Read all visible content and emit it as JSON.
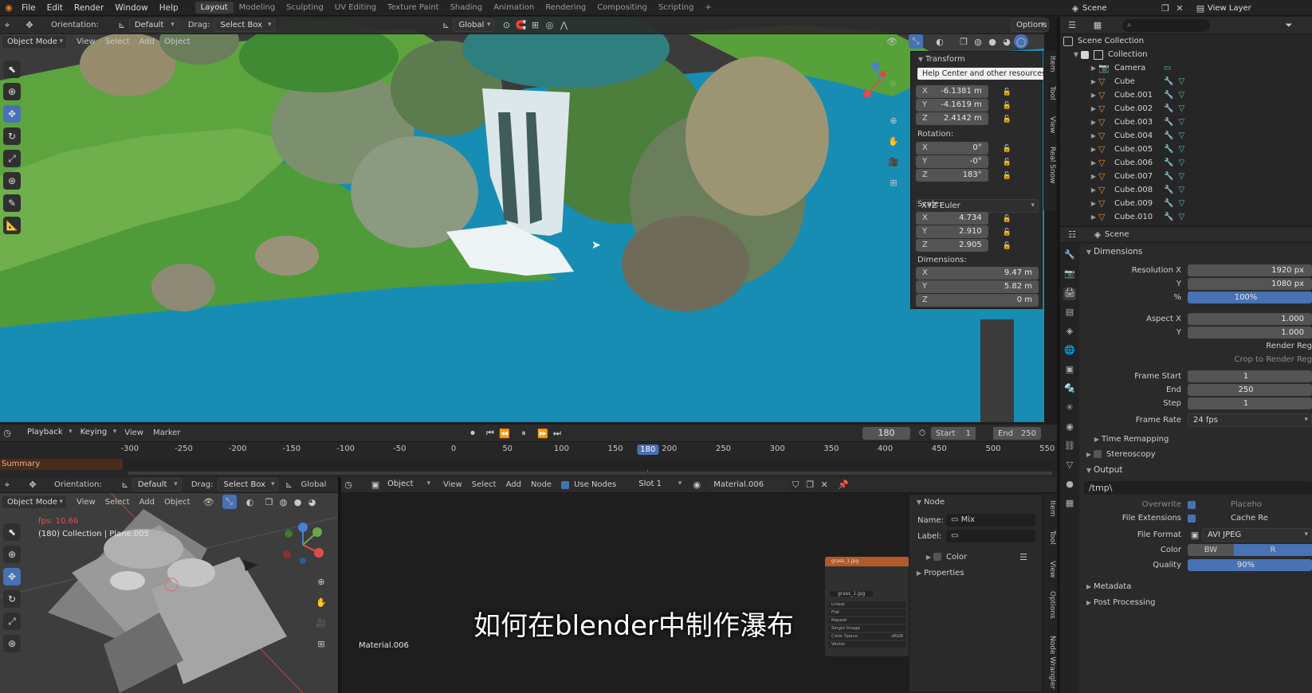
{
  "menu": [
    "File",
    "Edit",
    "Render",
    "Window",
    "Help"
  ],
  "workspaces": [
    "Layout",
    "Modeling",
    "Sculpting",
    "UV Editing",
    "Texture Paint",
    "Shading",
    "Animation",
    "Rendering",
    "Compositing",
    "Scripting",
    "+"
  ],
  "scene_name": "Scene",
  "view_layer": "View Layer",
  "vp_header": {
    "orientation_label": "Orientation:",
    "orientation": "Default",
    "drag_label": "Drag:",
    "drag": "Select Box",
    "transform_space": "Global",
    "options": "Options"
  },
  "vp_header2": {
    "mode": "Object Mode",
    "menus": [
      "View",
      "Select",
      "Add",
      "Object"
    ]
  },
  "npanel": {
    "title": "Transform",
    "tooltip": "Help Center and other resources",
    "location": [
      {
        "k": "X",
        "v": "-6.1381 m"
      },
      {
        "k": "Y",
        "v": "-4.1619 m"
      },
      {
        "k": "Z",
        "v": "2.4142 m"
      }
    ],
    "rotation_label": "Rotation:",
    "rotation": [
      {
        "k": "X",
        "v": "0°"
      },
      {
        "k": "Y",
        "v": "-0°"
      },
      {
        "k": "Z",
        "v": "183°"
      }
    ],
    "rotation_mode": "XYZ Euler",
    "scale_label": "Scale:",
    "scale": [
      {
        "k": "X",
        "v": "4.734"
      },
      {
        "k": "Y",
        "v": "2.910"
      },
      {
        "k": "Z",
        "v": "2.905"
      }
    ],
    "dimensions_label": "Dimensions:",
    "dimensions": [
      {
        "k": "X",
        "v": "9.47 m"
      },
      {
        "k": "Y",
        "v": "5.82 m"
      },
      {
        "k": "Z",
        "v": "0 m"
      }
    ],
    "tabs": [
      "Item",
      "Tool",
      "View",
      "Real Snow"
    ]
  },
  "timeline": {
    "menus": [
      "Playback",
      "Keying",
      "View",
      "Marker"
    ],
    "current_frame": "180",
    "start_label": "Start",
    "start": "1",
    "end_label": "End",
    "end": "250",
    "ticks": [
      "-300",
      "-250",
      "-200",
      "-150",
      "-100",
      "-50",
      "0",
      "50",
      "100",
      "150",
      "180",
      "200",
      "250",
      "300",
      "350",
      "400",
      "450",
      "500",
      "550"
    ],
    "summary": "Summary"
  },
  "outliner": {
    "root": "Scene Collection",
    "collection": "Collection",
    "items": [
      "Camera",
      "Cube",
      "Cube.001",
      "Cube.002",
      "Cube.003",
      "Cube.004",
      "Cube.005",
      "Cube.006",
      "Cube.007",
      "Cube.008",
      "Cube.009",
      "Cube.010"
    ]
  },
  "props": {
    "scene": "Scene",
    "dimensions_title": "Dimensions",
    "rows": [
      {
        "l": "Resolution X",
        "v": "1920 px"
      },
      {
        "l": "Y",
        "v": "1080 px"
      },
      {
        "l": "%",
        "v": "100%",
        "blue": true
      },
      {
        "l": "",
        "v": ""
      },
      {
        "l": "Aspect X",
        "v": "1.000"
      },
      {
        "l": "Y",
        "v": "1.000"
      }
    ],
    "render_region": "Render Reg",
    "crop": "Crop to Render Reg",
    "frames": [
      {
        "l": "Frame Start",
        "v": "1"
      },
      {
        "l": "End",
        "v": "250"
      },
      {
        "l": "Step",
        "v": "1"
      }
    ],
    "frame_rate_label": "Frame Rate",
    "frame_rate": "24 fps",
    "time_remapping": "Time Remapping",
    "stereoscopy": "Stereoscopy",
    "output": "Output",
    "path": "/tmp\\",
    "overwrite": "Overwrite",
    "placeholders": "Placeho",
    "file_ext": "File Extensions",
    "cache": "Cache Re",
    "file_format_label": "File Format",
    "file_format": "AVI JPEG",
    "color_label": "Color",
    "color_bw": "BW",
    "color_r": "R",
    "quality_label": "Quality",
    "quality": "90%",
    "metadata": "Metadata",
    "post": "Post Processing"
  },
  "bl_vp": {
    "orientation_label": "Orientation:",
    "orientation": "Default",
    "drag_label": "Drag:",
    "drag": "Select Box",
    "space": "Global",
    "mode": "Object Mode",
    "menus": [
      "View",
      "Select",
      "Add",
      "Object"
    ],
    "fps": "fps: 10.66",
    "info": "(180) Collection | Plane.005"
  },
  "node": {
    "type": "Object",
    "menus": [
      "View",
      "Select",
      "Add",
      "Node"
    ],
    "use_nodes": "Use Nodes",
    "slot": "Slot 1",
    "material": "Material.006",
    "footer": "Material.006",
    "panel_title": "Node",
    "name_label": "Name:",
    "name": "Mix",
    "label_label": "Label:",
    "color": "Color",
    "properties": "Properties",
    "tabs": [
      "Item",
      "Tool",
      "View",
      "Options",
      "Node Wrangler"
    ],
    "tex_node": {
      "title": "grass_1.jpg",
      "img": "grass_1.jpg",
      "rows": [
        "Linear",
        "Flat",
        "Repeat",
        "Single Image",
        "Color Space",
        "Vector"
      ],
      "cs": "sRGB"
    }
  },
  "subtitle": "如何在blender中制作瀑布",
  "colors": {
    "accent": "#4772b3",
    "water": "#1d8bb0",
    "timeline_marker": "#4772b3"
  }
}
